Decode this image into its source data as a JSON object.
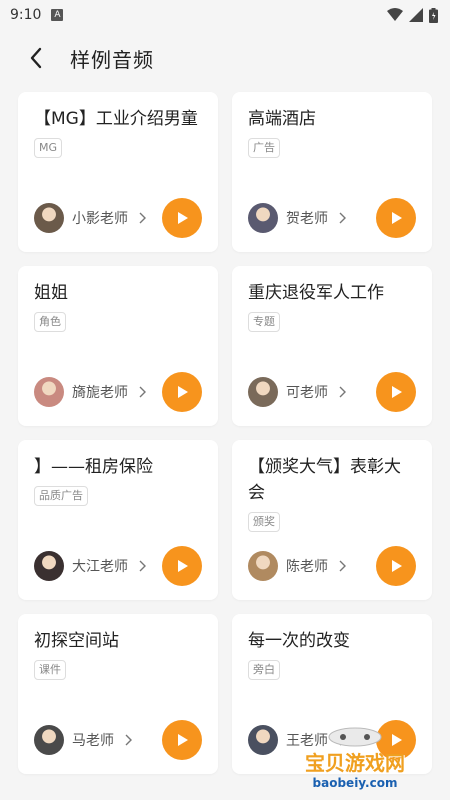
{
  "status": {
    "time": "9:10",
    "a_icon": "A"
  },
  "header": {
    "title": "样例音频"
  },
  "cards": [
    {
      "title": "【MG】工业介绍男童",
      "tag": "MG",
      "teacher": "小影老师",
      "avatar_color": "#6b5a4a"
    },
    {
      "title": "高端酒店",
      "tag": "广告",
      "teacher": "贺老师",
      "avatar_color": "#5a5a70"
    },
    {
      "title": "姐姐",
      "tag": "角色",
      "teacher": "旖旎老师",
      "avatar_color": "#c98a80"
    },
    {
      "title": "重庆退役军人工作",
      "tag": "专题",
      "teacher": "可老师",
      "avatar_color": "#7a6a5a"
    },
    {
      "title": "】——租房保险",
      "tag": "品质广告",
      "teacher": "大江老师",
      "avatar_color": "#3a3030"
    },
    {
      "title": "【颁奖大气】表彰大会",
      "tag": "颁奖",
      "teacher": "陈老师",
      "avatar_color": "#b08a60"
    },
    {
      "title": "初探空间站",
      "tag": "课件",
      "teacher": "马老师",
      "avatar_color": "#4a4a4a"
    },
    {
      "title": "每一次的改变",
      "tag": "旁白",
      "teacher": "王老师",
      "avatar_color": "#4a5060"
    }
  ],
  "watermark": {
    "text": "宝贝游戏网",
    "url": "baobeiy.com"
  },
  "colors": {
    "accent": "#f7941d",
    "background": "#f5f5f5"
  }
}
